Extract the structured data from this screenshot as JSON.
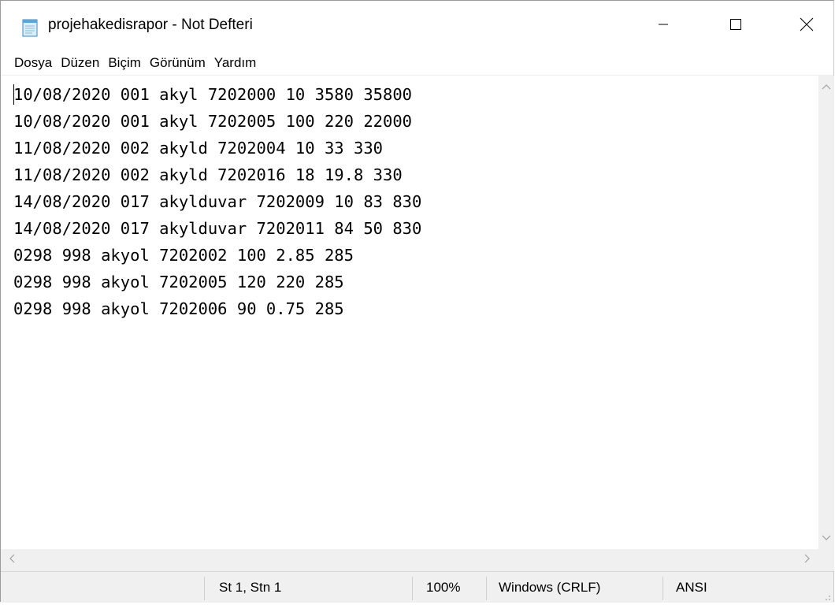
{
  "window": {
    "title": "projehakedisrapor - Not Defteri"
  },
  "menu": {
    "items": [
      "Dosya",
      "Düzen",
      "Biçim",
      "Görünüm",
      "Yardım"
    ]
  },
  "editor": {
    "lines": [
      "10/08/2020 001 akyl 7202000 10 3580 35800",
      "10/08/2020 001 akyl 7202005 100 220 22000",
      "11/08/2020 002 akyld 7202004 10 33 330",
      "11/08/2020 002 akyld 7202016 18 19.8 330",
      "14/08/2020 017 akylduvar 7202009 10 83 830",
      "14/08/2020 017 akylduvar 7202011 84 50 830",
      "0298 998 akyol 7202002 100 2.85 285",
      "0298 998 akyol 7202005 120 220 285",
      "0298 998 akyol 7202006 90 0.75 285"
    ]
  },
  "status": {
    "position": "St 1, Stn 1",
    "zoom": "100%",
    "line_ending": "Windows (CRLF)",
    "encoding": "ANSI"
  },
  "icons": {
    "app": "notepad-icon",
    "minimize": "minimize-icon",
    "maximize": "maximize-icon",
    "close": "close-icon"
  }
}
